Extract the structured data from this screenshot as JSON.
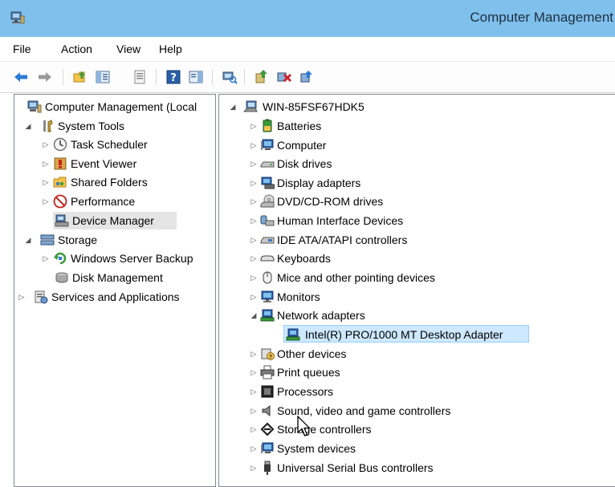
{
  "window": {
    "title": "Computer Management"
  },
  "menu": [
    {
      "label": "File"
    },
    {
      "label": "Action"
    },
    {
      "label": "View"
    },
    {
      "label": "Help"
    }
  ],
  "toolbar": {
    "buttons": [
      "back-arrow-icon",
      "forward-arrow-icon",
      "up-folder-icon",
      "show-hide-tree-icon",
      "properties-icon",
      "help-icon",
      "action-pane-icon",
      "scan-hardware-icon",
      "update-driver-icon",
      "disable-device-icon",
      "uninstall-device-icon"
    ]
  },
  "left_tree": [
    {
      "label": "Computer Management (Local",
      "icon": "computer-management-icon"
    },
    {
      "label": "System Tools",
      "icon": "system-tools-icon"
    },
    {
      "label": "Task Scheduler",
      "icon": "task-scheduler-icon"
    },
    {
      "label": "Event Viewer",
      "icon": "event-viewer-icon"
    },
    {
      "label": "Shared Folders",
      "icon": "shared-folders-icon"
    },
    {
      "label": "Performance",
      "icon": "performance-icon"
    },
    {
      "label": "Device Manager",
      "icon": "device-manager-icon",
      "selected": true
    },
    {
      "label": "Storage",
      "icon": "storage-icon"
    },
    {
      "label": "Windows Server Backup",
      "icon": "server-backup-icon"
    },
    {
      "label": "Disk Management",
      "icon": "disk-management-icon"
    },
    {
      "label": "Services and Applications",
      "icon": "services-icon"
    }
  ],
  "device_tree": {
    "root": {
      "label": "WIN-85FSF67HDK5",
      "icon": "computer-icon"
    },
    "categories": [
      {
        "label": "Batteries",
        "icon": "battery-icon"
      },
      {
        "label": "Computer",
        "icon": "computer-icon"
      },
      {
        "label": "Disk drives",
        "icon": "disk-drive-icon"
      },
      {
        "label": "Display adapters",
        "icon": "display-adapter-icon"
      },
      {
        "label": "DVD/CD-ROM drives",
        "icon": "dvd-drive-icon"
      },
      {
        "label": "Human Interface Devices",
        "icon": "hid-icon"
      },
      {
        "label": "IDE ATA/ATAPI controllers",
        "icon": "ide-controller-icon"
      },
      {
        "label": "Keyboards",
        "icon": "keyboard-icon"
      },
      {
        "label": "Mice and other pointing devices",
        "icon": "mouse-icon"
      },
      {
        "label": "Monitors",
        "icon": "monitor-icon"
      },
      {
        "label": "Network adapters",
        "icon": "network-adapter-icon",
        "expanded": true
      },
      {
        "label": "Intel(R) PRO/1000 MT Desktop Adapter",
        "icon": "network-adapter-icon",
        "child": true,
        "selected": true
      },
      {
        "label": "Other devices",
        "icon": "other-devices-icon"
      },
      {
        "label": "Print queues",
        "icon": "printer-icon"
      },
      {
        "label": "Processors",
        "icon": "processor-icon"
      },
      {
        "label": "Sound, video and game controllers",
        "icon": "sound-icon"
      },
      {
        "label": "Storage controllers",
        "icon": "storage-controller-icon"
      },
      {
        "label": "System devices",
        "icon": "system-devices-icon"
      },
      {
        "label": "Universal Serial Bus controllers",
        "icon": "usb-icon"
      }
    ]
  },
  "colors": {
    "titlebar": "#7fc0ec",
    "selection_blue": "#cde8ff",
    "selection_border": "#99d1ff",
    "selection_gray": "#e5e5e5"
  }
}
